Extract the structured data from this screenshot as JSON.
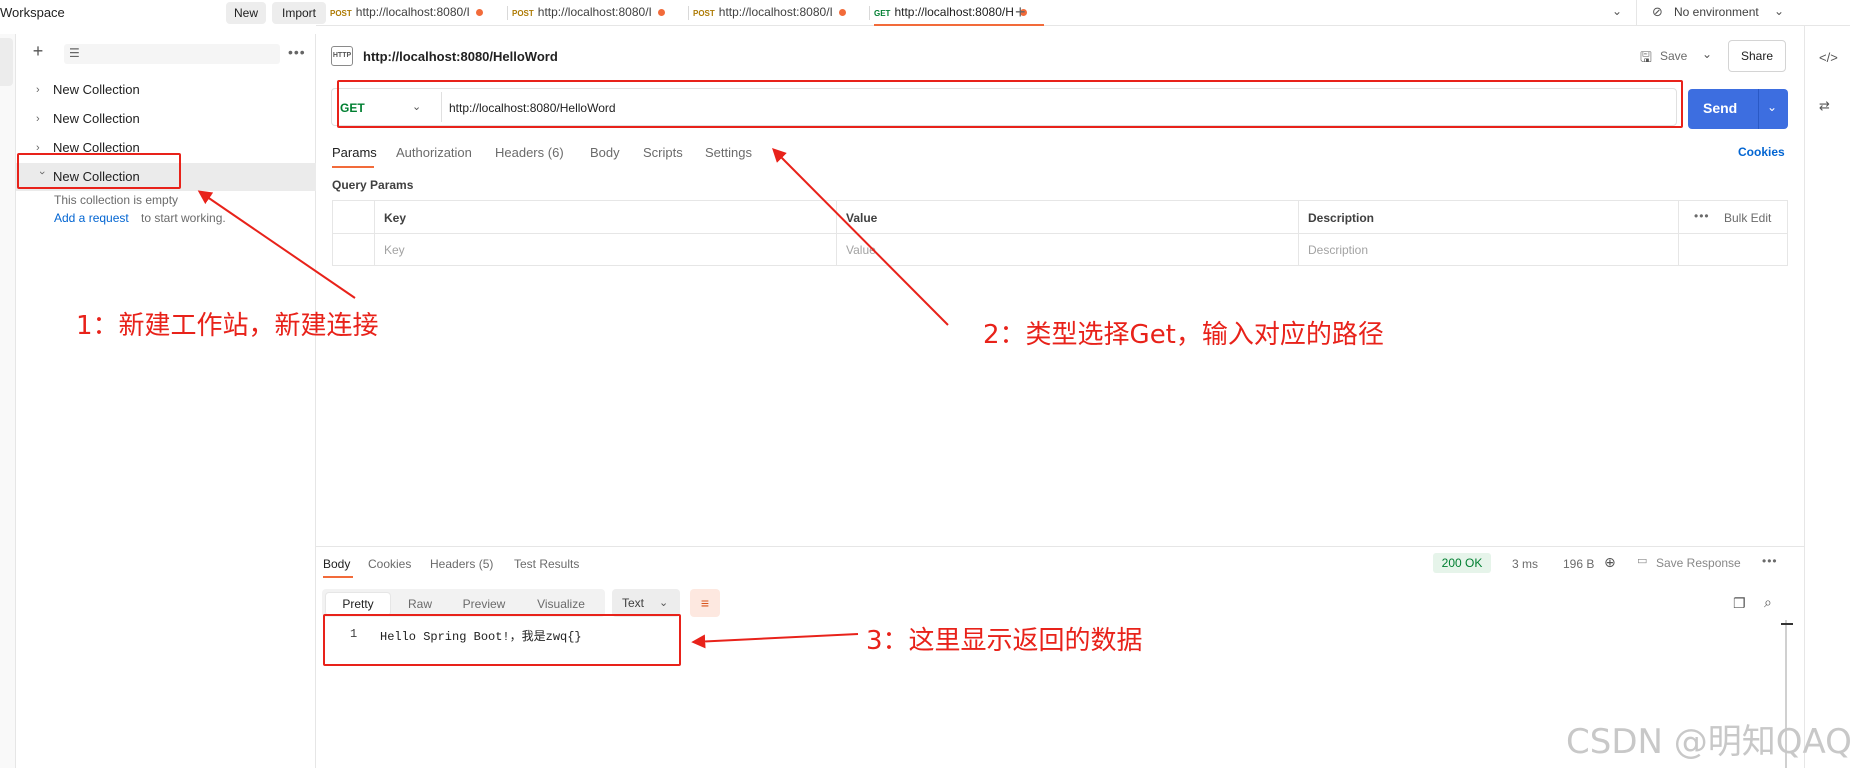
{
  "workspace": {
    "title": "Workspace",
    "new_label": "New",
    "import_label": "Import"
  },
  "tabs": [
    {
      "method": "POST",
      "url": "http://localhost:8080/I"
    },
    {
      "method": "POST",
      "url": "http://localhost:8080/I"
    },
    {
      "method": "POST",
      "url": "http://localhost:8080/I"
    },
    {
      "method": "GET",
      "url": "http://localhost:8080/H"
    }
  ],
  "environment": {
    "label": "No environment"
  },
  "sidebar": {
    "collections": [
      {
        "name": "New Collection"
      },
      {
        "name": "New Collection"
      },
      {
        "name": "New Collection"
      },
      {
        "name": "New Collection"
      }
    ],
    "empty_text": "This collection is empty",
    "add_request_link": "Add a request",
    "add_request_tail": "to start working."
  },
  "request": {
    "badge": "HTTP",
    "title": "http://localhost:8080/HelloWord",
    "save_label": "Save",
    "share_label": "Share",
    "method": "GET",
    "url": "http://localhost:8080/HelloWord",
    "send_label": "Send",
    "tabs": [
      "Params",
      "Authorization",
      "Headers",
      "Body",
      "Scripts",
      "Settings"
    ],
    "headers_count": "(6)",
    "cookies_label": "Cookies",
    "query_params_title": "Query Params",
    "params_headers": {
      "key": "Key",
      "value": "Value",
      "description": "Description"
    },
    "params_placeholders": {
      "key": "Key",
      "value": "Value",
      "description": "Description"
    },
    "bulk_edit_label": "Bulk Edit"
  },
  "response": {
    "tabs": [
      "Body",
      "Cookies",
      "Headers",
      "Test Results"
    ],
    "headers_count": "(5)",
    "status": "200 OK",
    "time": "3 ms",
    "size": "196 B",
    "save_response_label": "Save Response",
    "view_modes": [
      "Pretty",
      "Raw",
      "Preview",
      "Visualize"
    ],
    "format": "Text",
    "line_number": "1",
    "body_text": "Hello Spring Boot!，我是zwq{}"
  },
  "annotations": {
    "note1": "1：新建工作站，新建连接",
    "note2": "2：类型选择Get，输入对应的路径",
    "note3": "3：这里显示返回的数据",
    "color": "#e8221a"
  },
  "watermark": "CSDN @明知QAQ",
  "colors": {
    "accent": "#f26b3a",
    "send": "#3d6ee0",
    "get_method": "#007f31",
    "post_method": "#ad7a03",
    "link": "#0265d2"
  }
}
